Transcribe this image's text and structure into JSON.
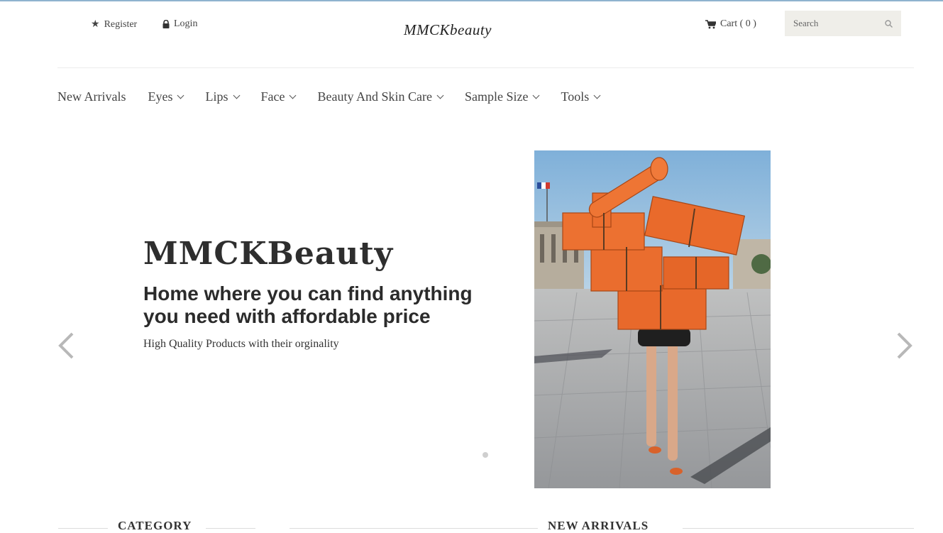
{
  "topbar": {
    "register_label": "Register",
    "login_label": "Login",
    "brand": "MMCKbeauty",
    "cart_label": "Cart ( 0 )",
    "search_placeholder": "Search"
  },
  "nav": {
    "items": [
      {
        "label": "New Arrivals",
        "dropdown": false
      },
      {
        "label": "Eyes",
        "dropdown": true
      },
      {
        "label": "Lips",
        "dropdown": true
      },
      {
        "label": "Face",
        "dropdown": true
      },
      {
        "label": "Beauty And Skin Care",
        "dropdown": true
      },
      {
        "label": "Sample Size",
        "dropdown": true
      },
      {
        "label": "Tools",
        "dropdown": true
      }
    ]
  },
  "hero": {
    "title": "MMCKBeauty",
    "subtitle": "Home where you can find anything you need with affordable price",
    "text": "High Quality Products with their orginality",
    "slide_count": 1,
    "active_slide": 1
  },
  "sections": {
    "category_title": "CATEGORY",
    "new_arrivals_title": "NEW ARRIVALS"
  },
  "colors": {
    "accent_orange": "#e8692b",
    "sky": "#8fb7d8",
    "pavement": "#a9aaac"
  },
  "icons": {
    "register": "star-icon",
    "login": "lock-icon",
    "cart": "cart-icon",
    "search": "search-icon",
    "prev": "chevron-left-icon",
    "next": "chevron-right-icon"
  }
}
